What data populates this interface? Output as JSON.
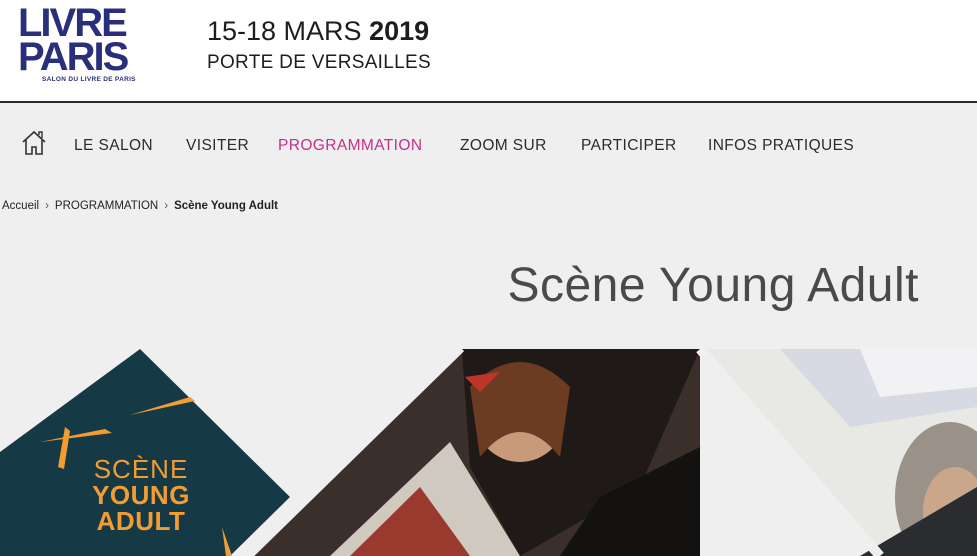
{
  "header": {
    "logo": {
      "line1": "LIVRE",
      "line2": "PARIS",
      "tagline": "SALON DU LIVRE DE PARIS"
    },
    "dates_prefix": "15-18 MARS ",
    "dates_year": "2019",
    "venue": "PORTE DE VERSAILLES"
  },
  "nav": {
    "home_icon": "home-icon",
    "items": [
      {
        "label": "LE SALON"
      },
      {
        "label": "VISITER"
      },
      {
        "label": "PROGRAMMATION",
        "active": true
      },
      {
        "label": "ZOOM SUR"
      },
      {
        "label": "PARTICIPER"
      },
      {
        "label": "INFOS PRATIQUES"
      }
    ],
    "active_color": "#c4308a"
  },
  "breadcrumb": {
    "items": [
      "Accueil",
      "PROGRAMMATION"
    ],
    "current": "Scène Young Adult"
  },
  "page_title": "Scène Young Adult",
  "hero": {
    "badge_line1": "SCÈNE",
    "badge_line2": "YOUNG",
    "badge_line3": "ADULT",
    "badge_bg": "#163a45",
    "badge_accent": "#f39c32"
  },
  "colors": {
    "brand": "#2a2f7c",
    "background": "#efefef"
  }
}
